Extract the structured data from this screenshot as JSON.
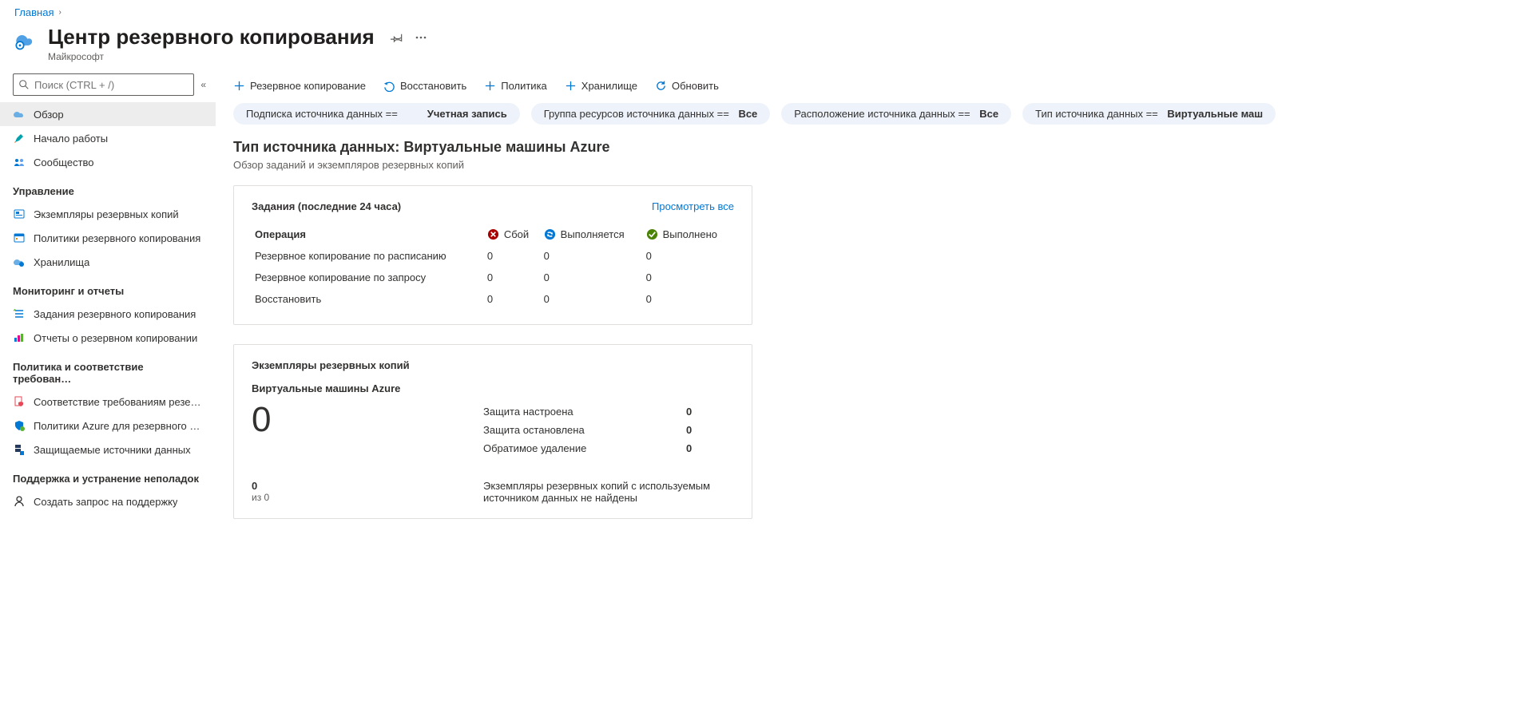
{
  "breadcrumb": {
    "home": "Главная"
  },
  "header": {
    "title": "Центр резервного копирования",
    "subtitle": "Майкрософт"
  },
  "search": {
    "placeholder": "Поиск (CTRL + /)"
  },
  "sidebar": {
    "items_top": [
      {
        "label": "Обзор"
      },
      {
        "label": "Начало работы"
      },
      {
        "label": "Сообщество"
      }
    ],
    "section_manage": "Управление",
    "items_manage": [
      {
        "label": "Экземпляры резервных копий"
      },
      {
        "label": "Политики резервного копирования"
      },
      {
        "label": "Хранилища"
      }
    ],
    "section_monitor": "Мониторинг и отчеты",
    "items_monitor": [
      {
        "label": "Задания резервного копирования"
      },
      {
        "label": "Отчеты о резервном копировании"
      }
    ],
    "section_policy": "Политика и соответствие требован…",
    "items_policy": [
      {
        "label": "Соответствие требованиям резер…"
      },
      {
        "label": "Политики Azure для резервного к…"
      },
      {
        "label": "Защищаемые источники данных"
      }
    ],
    "section_support": "Поддержка и устранение неполадок",
    "items_support": [
      {
        "label": "Создать запрос на поддержку"
      }
    ]
  },
  "toolbar": {
    "backup": "Резервное копирование",
    "restore": "Восстановить",
    "policy": "Политика",
    "vault": "Хранилище",
    "refresh": "Обновить"
  },
  "filters": {
    "f1_prefix": "Подписка источника данных ==",
    "f1_value": "Учетная запись",
    "f2_prefix": "Группа ресурсов источника данных ==",
    "f2_value": "Все",
    "f3_prefix": "Расположение источника данных ==",
    "f3_value": "Все",
    "f4_prefix": "Тип источника данных ==",
    "f4_value": "Виртуальные маш"
  },
  "content": {
    "title": "Тип источника данных: Виртуальные машины Azure",
    "subtitle": "Обзор заданий и экземпляров резервных копий"
  },
  "jobs_card": {
    "title": "Задания (последние 24 часа)",
    "view_all": "Просмотреть все",
    "col_operation": "Операция",
    "col_failed": "Сбой",
    "col_inprogress": "Выполняется",
    "col_completed": "Выполнено",
    "rows": [
      {
        "op": "Резервное копирование по расписанию",
        "failed": "0",
        "inprogress": "0",
        "completed": "0"
      },
      {
        "op": "Резервное копирование по запросу",
        "failed": "0",
        "inprogress": "0",
        "completed": "0"
      },
      {
        "op": "Восстановить",
        "failed": "0",
        "inprogress": "0",
        "completed": "0"
      }
    ]
  },
  "instances_card": {
    "title": "Экземпляры резервных копий",
    "subtitle": "Виртуальные машины Azure",
    "big_number": "0",
    "rows": [
      {
        "k": "Защита настроена",
        "v": "0"
      },
      {
        "k": "Защита остановлена",
        "v": "0"
      },
      {
        "k": "Обратимое удаление",
        "v": "0"
      }
    ],
    "footer_num": "0",
    "footer_denom": "из 0",
    "footer_text": "Экземпляры резервных копий с используемым источником данных не найдены"
  }
}
